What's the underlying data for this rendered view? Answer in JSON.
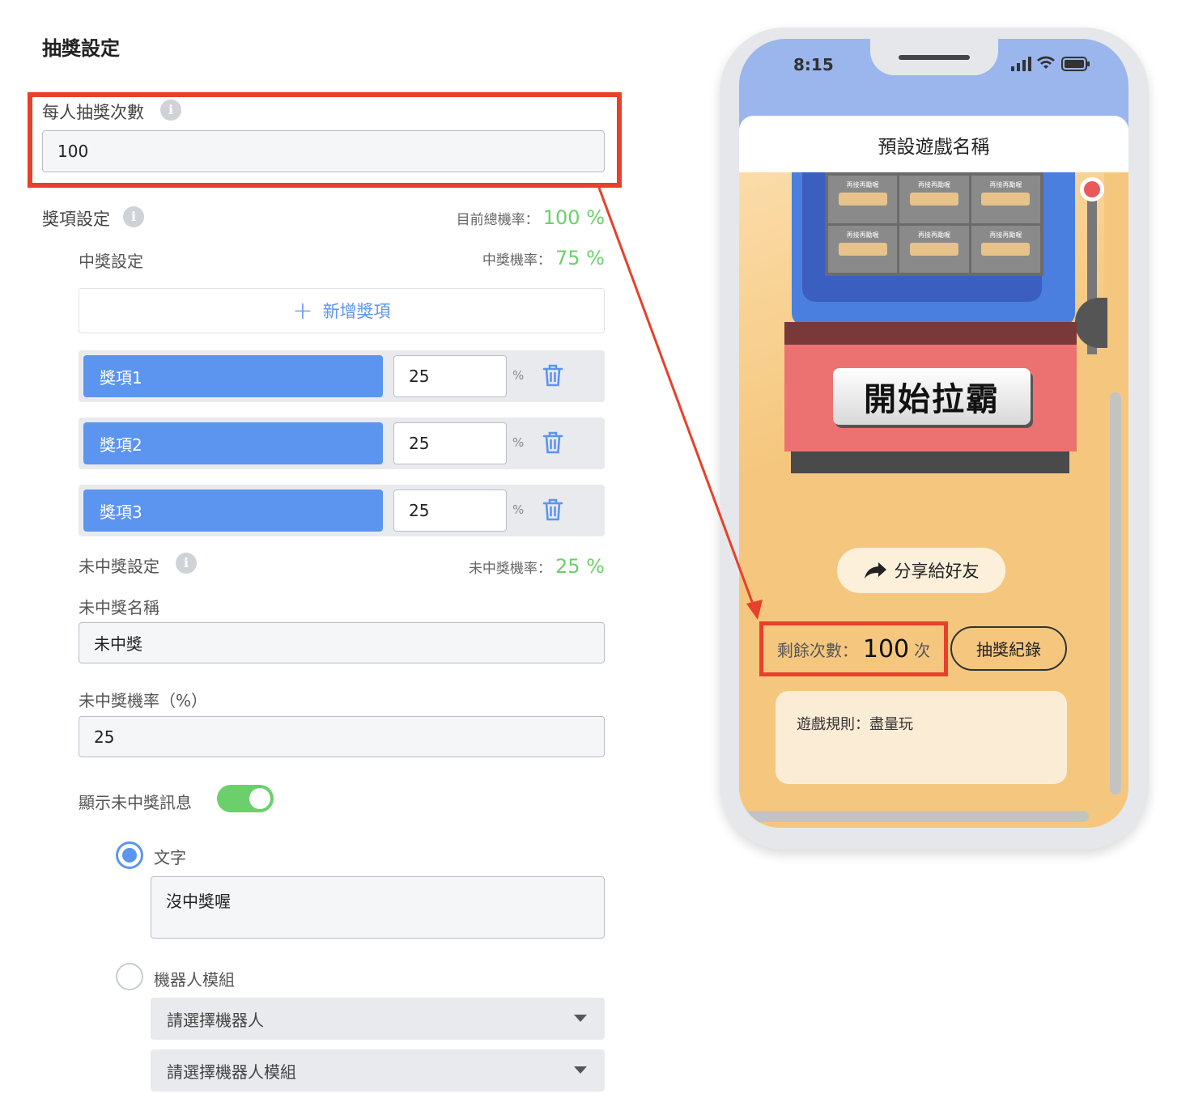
{
  "page_title": "抽獎設定",
  "per_person": {
    "label": "每人抽獎次數",
    "value": "100"
  },
  "prize_settings": {
    "label": "獎項設定",
    "total_rate_label": "目前總機率：",
    "total_rate_value": "100 %",
    "win_label": "中獎設定",
    "win_rate_label": "中獎機率：",
    "win_rate_value": "75 %",
    "add_button": "新增獎項",
    "items": [
      {
        "name": "獎項1",
        "value": "25",
        "unit": "%"
      },
      {
        "name": "獎項2",
        "value": "25",
        "unit": "%"
      },
      {
        "name": "獎項3",
        "value": "25",
        "unit": "%"
      }
    ]
  },
  "no_win": {
    "label": "未中獎設定",
    "rate_label": "未中獎機率：",
    "rate_value": "25 %",
    "name_label": "未中獎名稱",
    "name_value": "未中獎",
    "prob_label": "未中獎機率（%）",
    "prob_value": "25",
    "show_msg_label": "顯示未中獎訊息",
    "show_msg_on": true,
    "option_text_label": "文字",
    "text_value": "沒中獎喔",
    "option_bot_label": "機器人模組",
    "select_bot_placeholder": "請選擇機器人",
    "select_module_placeholder": "請選擇機器人模組"
  },
  "phone": {
    "time": "8:15",
    "game_title": "預設遊戲名稱",
    "pull_button": "開始拉霸",
    "share_button": "分享給好友",
    "remaining_label": "剩餘次數：",
    "remaining_value": "100",
    "remaining_unit": "次",
    "record_button": "抽獎紀錄",
    "rules_text": "遊戲規則：盡量玩",
    "reel_label": "再接再勵喔"
  },
  "colors": {
    "accent_blue": "#5b95f0",
    "rate_green": "#6bd06b",
    "highlight_red": "#e8402a",
    "game_bg": "#f5c77e"
  }
}
